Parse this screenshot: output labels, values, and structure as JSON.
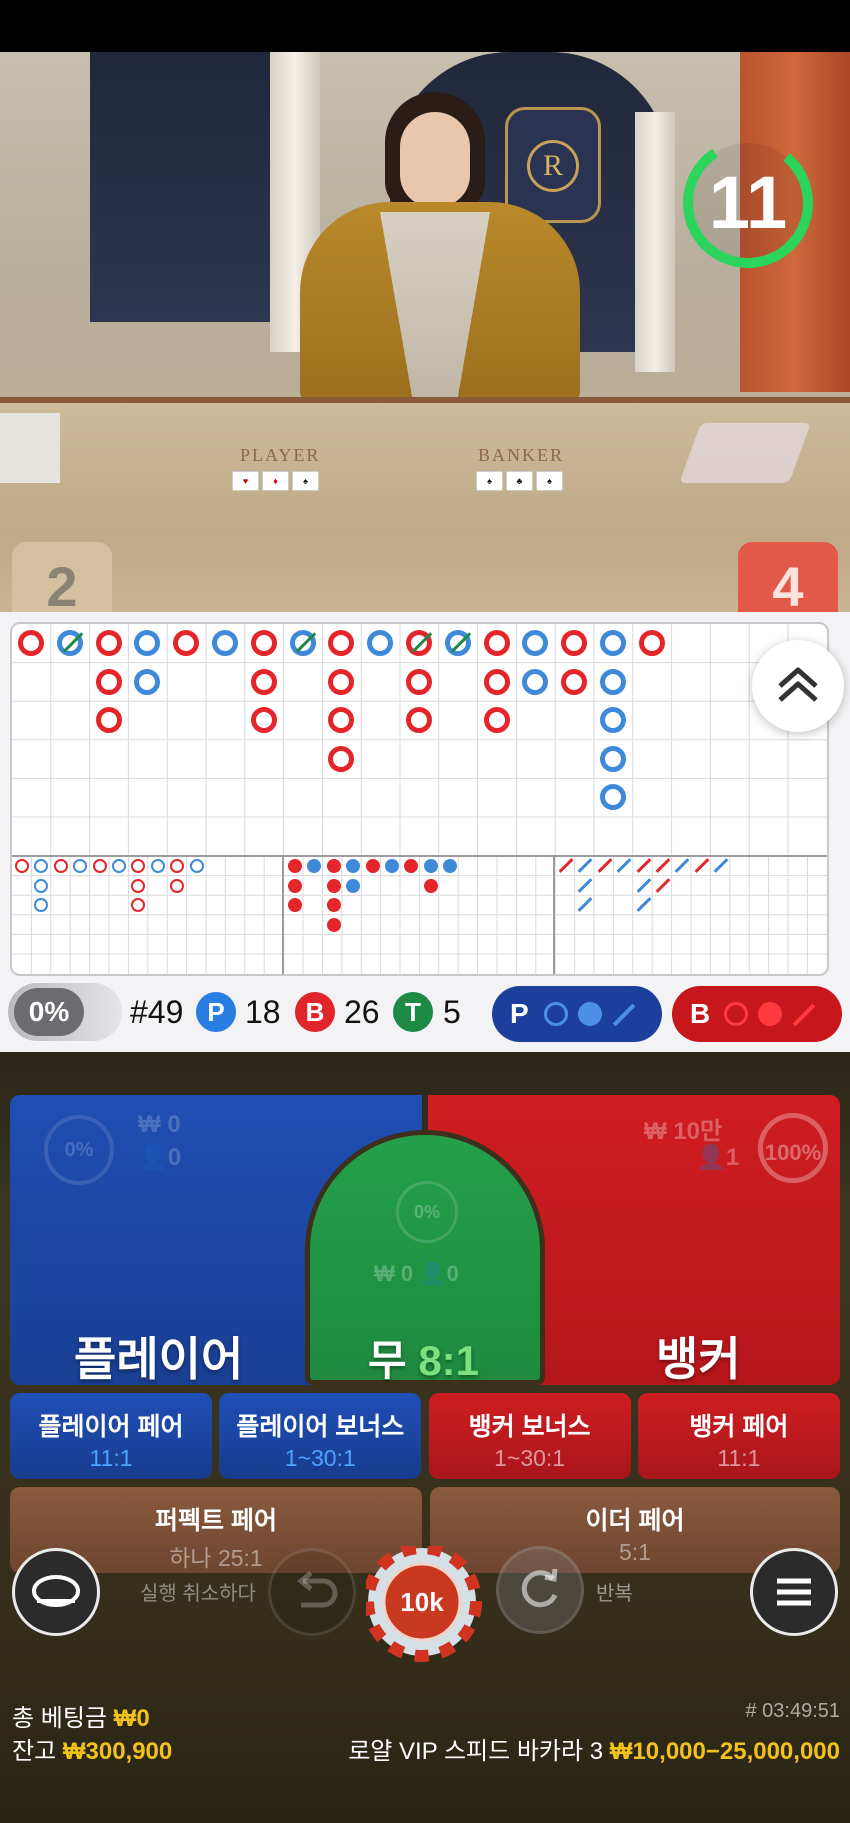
{
  "video": {
    "timer": "11",
    "player_score": "2",
    "banker_score": "4",
    "table_labels": {
      "player": "PLAYER",
      "banker": "BANKER"
    }
  },
  "roadmap": {
    "expand_icon": "double-chevron-up-icon",
    "big_road": [
      [
        "r"
      ],
      [
        "b*"
      ],
      [
        "r",
        "r",
        "r"
      ],
      [
        "b",
        "b"
      ],
      [
        "r"
      ],
      [
        "b"
      ],
      [
        "r",
        "r",
        "r"
      ],
      [
        "b*"
      ],
      [
        "r",
        "r",
        "r",
        "r"
      ],
      [
        "b"
      ],
      [
        "r*",
        "r",
        "r"
      ],
      [
        "b*"
      ],
      [
        "r",
        "r",
        "r"
      ],
      [
        "b",
        "b"
      ],
      [
        "r",
        "r"
      ],
      [
        "b",
        "b",
        "b",
        "b",
        "b"
      ],
      [
        "r"
      ]
    ]
  },
  "stats": {
    "percent": "0%",
    "round": "#49",
    "player_badge": "P",
    "player_count": "18",
    "banker_badge": "B",
    "banker_count": "26",
    "tie_badge": "T",
    "tie_count": "5",
    "player_predict_label": "P",
    "banker_predict_label": "B",
    "colors": {
      "player": "#2a7de1",
      "banker": "#e0262b",
      "tie": "#1d8a45"
    }
  },
  "betting": {
    "player": {
      "label": "플레이어",
      "amount": "₩ 0",
      "count": "0",
      "percent": "0%"
    },
    "tie": {
      "label": "무",
      "payout": "8:1",
      "amount": "₩ 0",
      "count": "0",
      "percent": "0%"
    },
    "banker": {
      "label": "뱅커",
      "amount": "₩ 10만",
      "count": "1",
      "percent": "100%"
    },
    "side_bets": [
      {
        "label": "플레이어 페어",
        "payout": "11:1"
      },
      {
        "label": "플레이어 보너스",
        "payout": "1~30:1"
      },
      {
        "label": "뱅커 보너스",
        "payout": "1~30:1"
      },
      {
        "label": "뱅커 페어",
        "payout": "11:1"
      }
    ],
    "perfect_pair": {
      "label": "퍼펙트 페어",
      "payout": "하나 25:1"
    },
    "either_pair": {
      "label": "이더 페어",
      "payout": "5:1"
    }
  },
  "controls": {
    "undo_label": "실행 취소하다",
    "chip_value": "10k",
    "repeat_label": "반복"
  },
  "footer": {
    "total_bet_label": "총 베팅금",
    "total_bet_value": "₩0",
    "balance_label": "잔고",
    "balance_value": "₩300,900",
    "round_id": "# 03:49:51",
    "table_name": "로얄 VIP 스피드 바카라 3",
    "limits": "₩10,000−25,000,000"
  }
}
